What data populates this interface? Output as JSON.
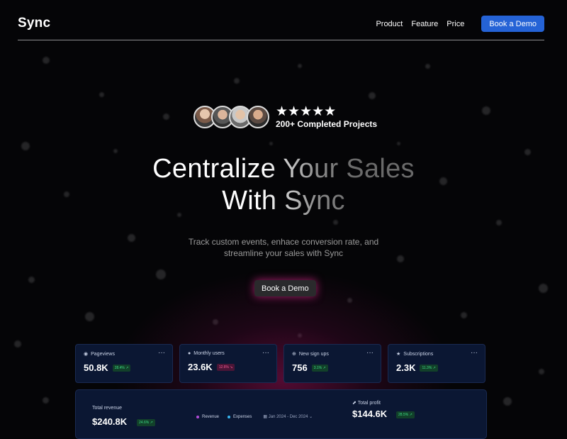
{
  "nav": {
    "logo": "Sync",
    "links": [
      "Product",
      "Feature",
      "Price"
    ],
    "cta": "Book a Demo"
  },
  "proof": {
    "stars": "★★★★★",
    "label": "200+ Completed Projects"
  },
  "hero": {
    "title_line1": "Centralize Your Sales",
    "title_line2": "With Sync",
    "subtitle_line1": "Track custom events, enhace conversion rate, and",
    "subtitle_line2": "streamline your sales with Sync",
    "cta": "Book a Demo"
  },
  "stats": [
    {
      "label": "Pageviews",
      "value": "50.8K",
      "change": "28.4% ↗",
      "trend": "up",
      "icon": "eye-icon"
    },
    {
      "label": "Monthly users",
      "value": "23.6K",
      "change": "12.6% ↘",
      "trend": "down",
      "icon": "user-icon"
    },
    {
      "label": "New sign ups",
      "value": "756",
      "change": "3.1% ↗",
      "trend": "up",
      "icon": "plus-circle-icon"
    },
    {
      "label": "Subscriptions",
      "value": "2.3K",
      "change": "11.3% ↗",
      "trend": "up",
      "icon": "star-icon"
    }
  ],
  "panel": {
    "revenue_label": "Total revenue",
    "revenue_value": "$240.8K",
    "revenue_change": "24.6% ↗",
    "legend_revenue": "Revenue",
    "legend_expenses": "Expenses",
    "date_range": "Jan 2024 - Dec 2024",
    "profit_label": "Total profit",
    "profit_value": "$144.6K",
    "profit_change": "28.5% ↗"
  },
  "colors": {
    "accent": "#2563d6",
    "card_bg": "#0b1733",
    "glow": "#be146e",
    "revenue_dot": "#b04ad6",
    "expenses_dot": "#38b6f0"
  }
}
